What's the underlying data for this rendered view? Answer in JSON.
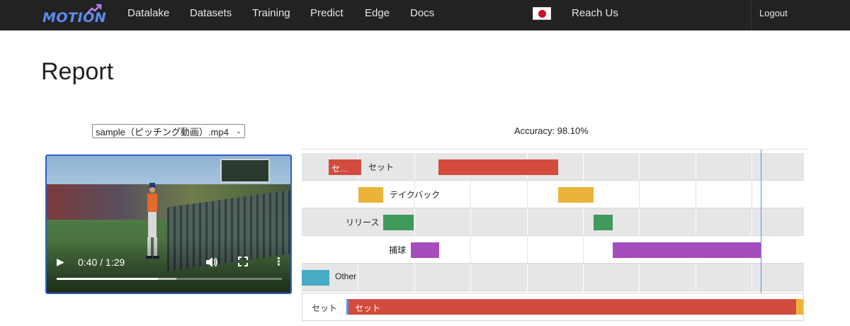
{
  "nav": {
    "logo_text": "MOTION",
    "links": [
      "Datalake",
      "Datasets",
      "Training",
      "Predict",
      "Edge",
      "Docs"
    ],
    "reach_us": "Reach Us",
    "logout": "Logout"
  },
  "page": {
    "title": "Report"
  },
  "video_select": {
    "selected": "sample（ピッチング動画）.mp4"
  },
  "accuracy_text": "Accuracy: 98.10%",
  "video": {
    "time": "0:40 / 1:29",
    "progress": 0.45,
    "buffered": 0.53
  },
  "timeline": {
    "rows": [
      {
        "label": "セット",
        "color": "#d24c3e",
        "bar_text": "セ…"
      },
      {
        "label": "テイクバック",
        "color": "#ecb33a"
      },
      {
        "label": "リリース",
        "color": "#3f9a5c"
      },
      {
        "label": "捕球",
        "color": "#a64dbd"
      },
      {
        "label": "Other",
        "color": "#47abc6"
      }
    ]
  },
  "current_strip": {
    "label": "セット",
    "bar_text": "セット"
  },
  "colors": {
    "accent": "#5b8def",
    "nav_bg": "#222222"
  }
}
